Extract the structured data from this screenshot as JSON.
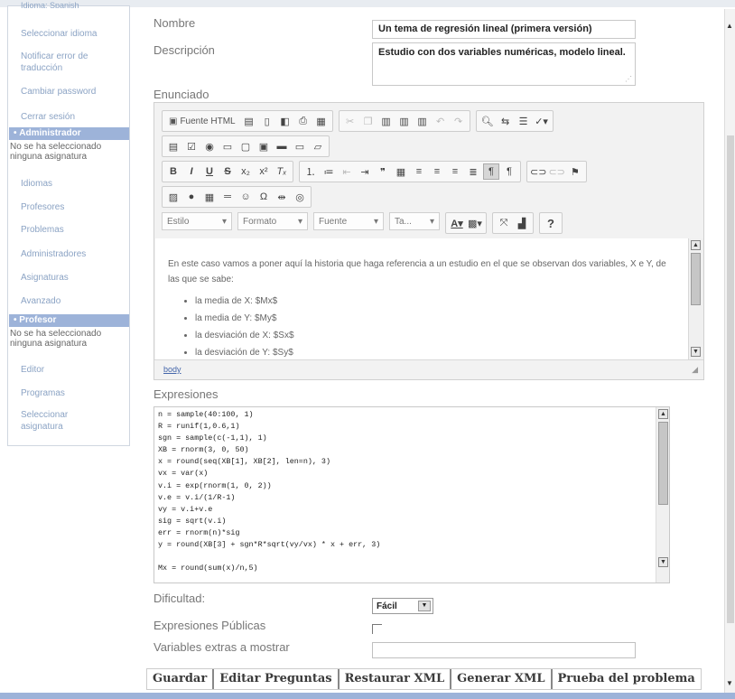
{
  "sidebar": {
    "top_partial": "Idioma: Spanish",
    "links_top": [
      "Seleccionar idioma",
      "Notificar error de traducción",
      "Cambiar password",
      "Cerrar sesión"
    ],
    "admin_header": "Administrador",
    "admin_note": "No se ha seleccionado ninguna asignatura",
    "admin_links": [
      "Idiomas",
      "Profesores",
      "Problemas",
      "Administradores",
      "Asignaturas",
      "Avanzado"
    ],
    "prof_header": "Profesor",
    "prof_note": "No se ha seleccionado ninguna asignatura",
    "prof_links": [
      "Editor",
      "Programas",
      "Seleccionar asignatura"
    ]
  },
  "form": {
    "nombre_label": "Nombre",
    "nombre_value": "Un tema de regresión lineal (primera versión)",
    "descripcion_label": "Descripción",
    "descripcion_value": "Estudio con dos variables numéricas, modelo lineal.",
    "enunciado_label": "Enunciado",
    "expresiones_label": "Expresiones",
    "dificultad_label": "Dificultad:",
    "dificultad_value": "Fácil",
    "publicas_label": "Expresiones Públicas",
    "extras_label": "Variables extras a mostrar",
    "extras_value": ""
  },
  "editor": {
    "source_label": "Fuente HTML",
    "combos": [
      "Estilo",
      "Formato",
      "Fuente",
      "Ta..."
    ],
    "help": "?",
    "paragraph": "En este caso vamos a poner aquí la historia que haga referencia a un estudio en el que se observan dos variables, X e Y, de las que se sabe:",
    "bullets": [
      "la media de X: $Mx$",
      "la media de Y: $My$",
      "la desviación de X: $Sx$",
      "la desviación de Y: $Sy$"
    ],
    "path": "body"
  },
  "expressions": [
    "n = sample(40:100, 1)",
    "R = runif(1,0.6,1)",
    "sgn = sample(c(-1,1), 1)",
    "XB = rnorm(3, 0, 50)",
    "x = round(seq(XB[1], XB[2], len=n), 3)",
    "vx = var(x)",
    "v.i = exp(rnorm(1, 0, 2))",
    "v.e = v.i/(1/R-1)",
    "vy = v.i+v.e",
    "sig = sqrt(v.i)",
    "err = rnorm(n)*sig",
    "y = round(XB[3] + sgn*R*sqrt(vy/vx) * x + err, 3)",
    "",
    "Mx = round(sum(x)/n,5)"
  ],
  "buttons": [
    "Guardar",
    "Editar Preguntas",
    "Restaurar XML",
    "Generar XML",
    "Prueba del problema"
  ],
  "colors": {
    "sidebar_header": "#9db3d9",
    "sidebar_link": "#8ba3c4",
    "editor_bg": "#f2f2f2"
  }
}
